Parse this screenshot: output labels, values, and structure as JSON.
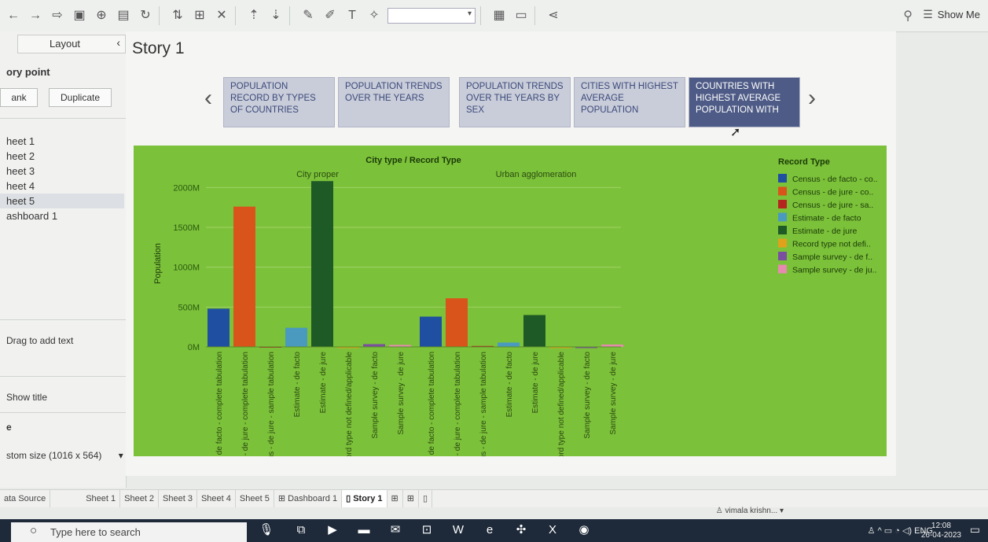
{
  "toolbar": {
    "icons": [
      "back-icon",
      "forward-icon",
      "redo-icon",
      "save-icon",
      "new-datasource-icon",
      "new-sheet-icon",
      "refresh-icon",
      "swap-icon",
      "clear-icon",
      "group-icon",
      "sort-asc-icon",
      "sort-desc-icon",
      "highlight-icon",
      "annotate-icon",
      "text-icon",
      "pin-icon"
    ],
    "show_me_label": "Show Me"
  },
  "left_panel": {
    "layout_tab": "Layout",
    "story_point_title": "ory point",
    "blank_btn": "ank",
    "duplicate_btn": "Duplicate",
    "sheets": [
      "heet 1",
      "heet 2",
      "heet 3",
      "heet 4",
      "heet 5",
      "ashboard 1"
    ],
    "drag_text": "Drag to add text",
    "show_title": "Show title",
    "size_header": "e",
    "size_value": "stom size (1016 x 564)"
  },
  "story": {
    "title": "Story 1",
    "points": [
      "POPULATION RECORD BY TYPES OF COUNTRIES",
      "POPULATION TRENDS OVER THE YEARS",
      "POPULATION TRENDS OVER THE YEARS BY SEX",
      "CITIES WITH HIGHEST AVERAGE POPULATION",
      "COUNTRIES WITH HIGHEST AVERAGE POPULATION WITH"
    ]
  },
  "chart_data": {
    "type": "bar",
    "title": "City type / Record Type",
    "groups": [
      "City proper",
      "Urban agglomeration"
    ],
    "ylabel": "Population",
    "yticks": [
      "0M",
      "500M",
      "1000M",
      "1500M",
      "2000M"
    ],
    "ylim": [
      0,
      2250
    ],
    "legend_title": "Record Type",
    "legend": [
      {
        "name": "Census - de facto - co..",
        "color": "#1f4fa0"
      },
      {
        "name": "Census - de jure - co..",
        "color": "#d9541a"
      },
      {
        "name": "Census - de jure - sa..",
        "color": "#b5261e"
      },
      {
        "name": "Estimate - de facto",
        "color": "#4a9ac0"
      },
      {
        "name": "Estimate - de jure",
        "color": "#1e5a26"
      },
      {
        "name": "Record type not defi..",
        "color": "#e0a21a"
      },
      {
        "name": "Sample survey - de f..",
        "color": "#7a4fa0"
      },
      {
        "name": "Sample survey - de ju..",
        "color": "#e68ab0"
      }
    ],
    "categories": [
      "Census - de facto - complete tabulation",
      "Census - de jure - complete tabulation",
      "Census - de jure - sample tabulation",
      "Estimate - de facto",
      "Estimate - de jure",
      "Record type not defined/applicable",
      "Sample survey - de facto",
      "Sample survey - de jure"
    ],
    "series": [
      {
        "name": "City proper",
        "values": [
          480,
          1760,
          5,
          240,
          2080,
          0,
          35,
          25
        ]
      },
      {
        "name": "Urban agglomeration",
        "values": [
          380,
          610,
          12,
          55,
          400,
          0,
          0,
          30
        ]
      }
    ]
  },
  "tabs": [
    "ata Source",
    "Sheet 1",
    "Sheet 2",
    "Sheet 3",
    "Sheet 4",
    "Sheet 5",
    "Dashboard 1",
    "Story 1"
  ],
  "user": "vimala krishn...",
  "taskbar": {
    "search_placeholder": "Type here to search",
    "tray_lang": "ENG",
    "time": "12:08",
    "date": "26-04-2023"
  }
}
